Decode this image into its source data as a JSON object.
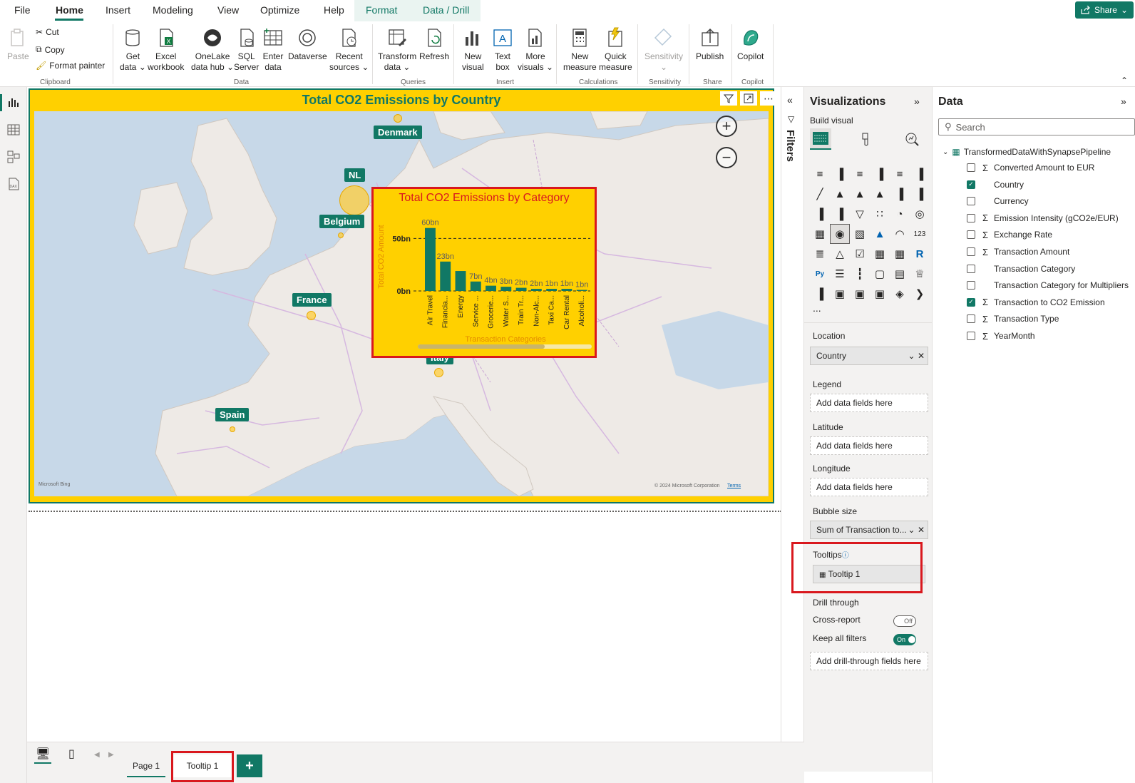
{
  "menu": {
    "tabs": [
      "File",
      "Home",
      "Insert",
      "Modeling",
      "View",
      "Optimize",
      "Help",
      "Format",
      "Data / Drill"
    ],
    "share": "Share"
  },
  "ribbon": {
    "clipboard": {
      "paste": "Paste",
      "cut": "Cut",
      "copy": "Copy",
      "format_painter": "Format painter",
      "label": "Clipboard"
    },
    "data": {
      "get_data": [
        "Get",
        "data ⌄"
      ],
      "excel": [
        "Excel",
        "workbook"
      ],
      "onelake": [
        "OneLake",
        "data hub ⌄"
      ],
      "sql": [
        "SQL",
        "Server"
      ],
      "enter": [
        "Enter",
        "data"
      ],
      "dataverse": [
        "Dataverse",
        ""
      ],
      "recent": [
        "Recent",
        "sources ⌄"
      ],
      "label": "Data"
    },
    "queries": {
      "transform": [
        "Transform",
        "data ⌄"
      ],
      "refresh": [
        "Refresh",
        ""
      ],
      "label": "Queries"
    },
    "insert": {
      "new_visual": [
        "New",
        "visual"
      ],
      "text_box": [
        "Text",
        "box"
      ],
      "more_visuals": [
        "More",
        "visuals ⌄"
      ],
      "label": "Insert"
    },
    "calculations": {
      "new_measure": [
        "New",
        "measure"
      ],
      "quick_measure": [
        "Quick",
        "measure"
      ],
      "label": "Calculations"
    },
    "sensitivity": {
      "btn": [
        "Sensitivity",
        "⌄"
      ],
      "label": "Sensitivity"
    },
    "share": {
      "publish": "Publish",
      "label": "Share"
    },
    "copilot": {
      "btn": "Copilot",
      "label": "Copilot"
    }
  },
  "visual": {
    "title": "Total CO2 Emissions by Country",
    "labels": {
      "denmark": "Denmark",
      "nl": "NL",
      "belgium": "Belgium",
      "france": "France",
      "italy": "Italy",
      "spain": "Spain"
    },
    "footer_left": "Microsoft Bing",
    "footer_right": "© 2024 Microsoft Corporation",
    "footer_terms": "Terms"
  },
  "tooltip_chart": {
    "title": "Total CO2 Emissions by Category",
    "ylabel": "Total CO2 Amount",
    "xlabel": "Transaction Categories"
  },
  "chart_data": {
    "type": "bar",
    "title": "Total CO2 Emissions by Category",
    "xlabel": "Transaction Categories",
    "ylabel": "Total CO2 Amount",
    "categories": [
      "Air Travel",
      "Financia...",
      "Energy",
      "Service ...",
      "Grocerie...",
      "Water S...",
      "Train Tr...",
      "Non-Alc...",
      "Taxi Ca...",
      "Car Rental",
      "Alcoholi..."
    ],
    "values": [
      60,
      28,
      19,
      9,
      5,
      4,
      3,
      2,
      2,
      2,
      1
    ],
    "data_labels": [
      "60bn",
      "23bn",
      "",
      "7bn",
      "4bn",
      "3bn",
      "2bn",
      "2bn",
      "1bn",
      "1bn",
      "1bn"
    ],
    "yticks": [
      "0bn",
      "50bn"
    ],
    "ylim": [
      0,
      70
    ],
    "reference_line": 50,
    "bar_color": "#117865"
  },
  "filters": {
    "label": "Filters"
  },
  "viz_pane": {
    "title": "Visualizations",
    "build_visual": "Build visual",
    "more": "...",
    "wells": {
      "location": {
        "label": "Location",
        "value": "Country"
      },
      "legend": {
        "label": "Legend",
        "placeholder": "Add data fields here"
      },
      "latitude": {
        "label": "Latitude",
        "placeholder": "Add data fields here"
      },
      "longitude": {
        "label": "Longitude",
        "placeholder": "Add data fields here"
      },
      "bubble_size": {
        "label": "Bubble size",
        "value": "Sum of Transaction to..."
      },
      "tooltips": {
        "label": "Tooltips",
        "value": "Tooltip 1"
      }
    },
    "drill": {
      "title": "Drill through",
      "cross_report": "Cross-report",
      "cross_report_state": "Off",
      "keep_filters": "Keep all filters",
      "keep_filters_state": "On",
      "add_fields": "Add drill-through fields here"
    }
  },
  "data_pane": {
    "title": "Data",
    "search_placeholder": "Search",
    "table": "TransformedDataWithSynapsePipeline",
    "fields": [
      {
        "name": "Converted Amount to EUR",
        "sigma": true,
        "checked": false
      },
      {
        "name": "Country",
        "sigma": false,
        "checked": true
      },
      {
        "name": "Currency",
        "sigma": false,
        "checked": false
      },
      {
        "name": "Emission Intensity (gCO2e/EUR)",
        "sigma": true,
        "checked": false
      },
      {
        "name": "Exchange Rate",
        "sigma": true,
        "checked": false
      },
      {
        "name": "Transaction Amount",
        "sigma": true,
        "checked": false
      },
      {
        "name": "Transaction Category",
        "sigma": false,
        "checked": false
      },
      {
        "name": "Transaction Category for Multipliers",
        "sigma": false,
        "checked": false
      },
      {
        "name": "Transaction to CO2 Emission",
        "sigma": true,
        "checked": true
      },
      {
        "name": "Transaction Type",
        "sigma": true,
        "checked": false
      },
      {
        "name": "YearMonth",
        "sigma": true,
        "checked": false
      }
    ]
  },
  "pages": {
    "page1": "Page 1",
    "tooltip1": "Tooltip 1",
    "add": "+"
  },
  "colors": {
    "accent": "#117865",
    "visual_bg": "#ffd000",
    "highlight": "#d9181e"
  }
}
